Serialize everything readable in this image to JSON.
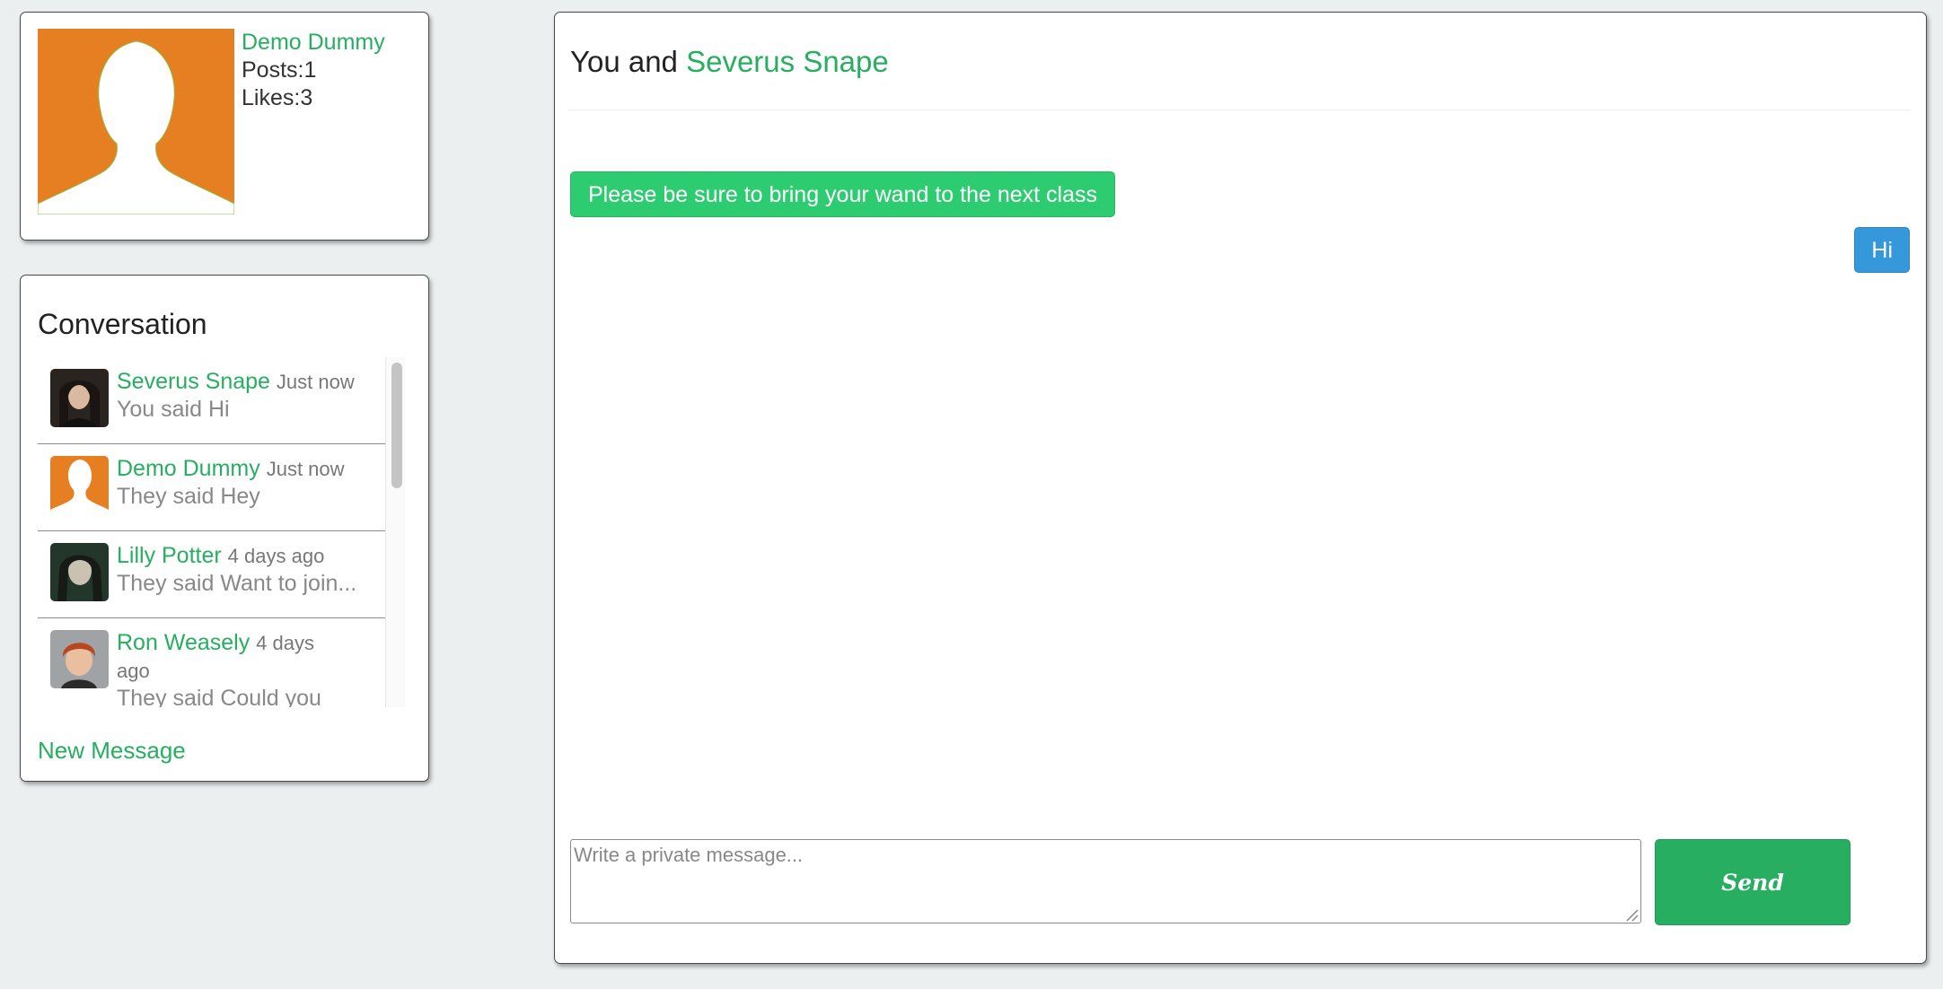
{
  "profile": {
    "name": "Demo Dummy",
    "posts_label": "Posts:",
    "posts": "1",
    "likes_label": "Likes:",
    "likes": "3",
    "avatar_color": "#e67e22"
  },
  "conversation": {
    "title": "Conversation",
    "items": [
      {
        "name": "Severus Snape",
        "time": "Just now",
        "preview": "You said Hi",
        "avatar": "portrait-severus-snape"
      },
      {
        "name": "Demo Dummy",
        "time": "Just now",
        "preview": "They said Hey",
        "avatar": "silhouette-avatar"
      },
      {
        "name": "Lilly Potter",
        "time": "4 days ago",
        "preview": "They said Want to join...",
        "avatar": "portrait-lilly-potter"
      },
      {
        "name": "Ron Weasely",
        "time": "4 days ago",
        "preview": "They said Could you se...",
        "avatar": "portrait-ron-weasely"
      }
    ],
    "new_message_label": "New Message"
  },
  "chat": {
    "header_prefix": "You and ",
    "header_name": "Severus Snape",
    "messages": [
      {
        "direction": "incoming",
        "text": "Please be sure to bring your wand to the next class"
      },
      {
        "direction": "outgoing",
        "text": "Hi"
      }
    ],
    "input_placeholder": "Write a private message...",
    "input_value": "",
    "send_label": "Send"
  },
  "colors": {
    "accent_green": "#27ae60",
    "incoming_bubble": "#2ecc71",
    "outgoing_bubble": "#3498db",
    "background": "#ebeff0"
  }
}
